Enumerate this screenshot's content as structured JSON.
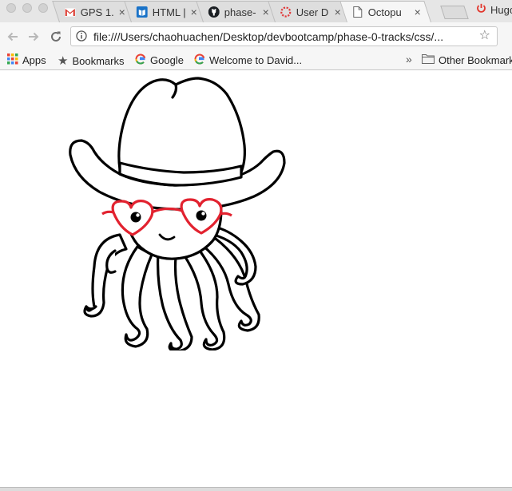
{
  "window": {
    "tabs": [
      {
        "title": "GPS 1.",
        "icon": "gmail-icon",
        "active": false
      },
      {
        "title": "HTML |",
        "icon": "book-icon",
        "active": false
      },
      {
        "title": "phase-",
        "icon": "github-icon",
        "active": false
      },
      {
        "title": "User D",
        "icon": "loading-icon",
        "active": false
      },
      {
        "title": "Octopu",
        "icon": "page-icon",
        "active": true
      }
    ],
    "extra_tab": {
      "title": "Hugo",
      "icon": "power-icon"
    },
    "close_glyph": "×"
  },
  "toolbar": {
    "url": "file:///Users/chaohuachen/Desktop/devbootcamp/phase-0-tracks/css/..."
  },
  "bookmarks": {
    "items": [
      {
        "label": "Apps",
        "icon": "apps-grid-icon"
      },
      {
        "label": "Bookmarks",
        "icon": "star-icon"
      },
      {
        "label": "Google",
        "icon": "google-icon"
      },
      {
        "label": "Welcome to David...",
        "icon": "google-icon"
      }
    ],
    "more_glyph": "»",
    "other": {
      "label": "Other Bookmarks",
      "icon": "folder-icon"
    }
  },
  "page": {
    "image": {
      "subject": "octopus-with-cowboy-hat-and-heart-glasses",
      "accent_color": "#e2222f"
    }
  }
}
